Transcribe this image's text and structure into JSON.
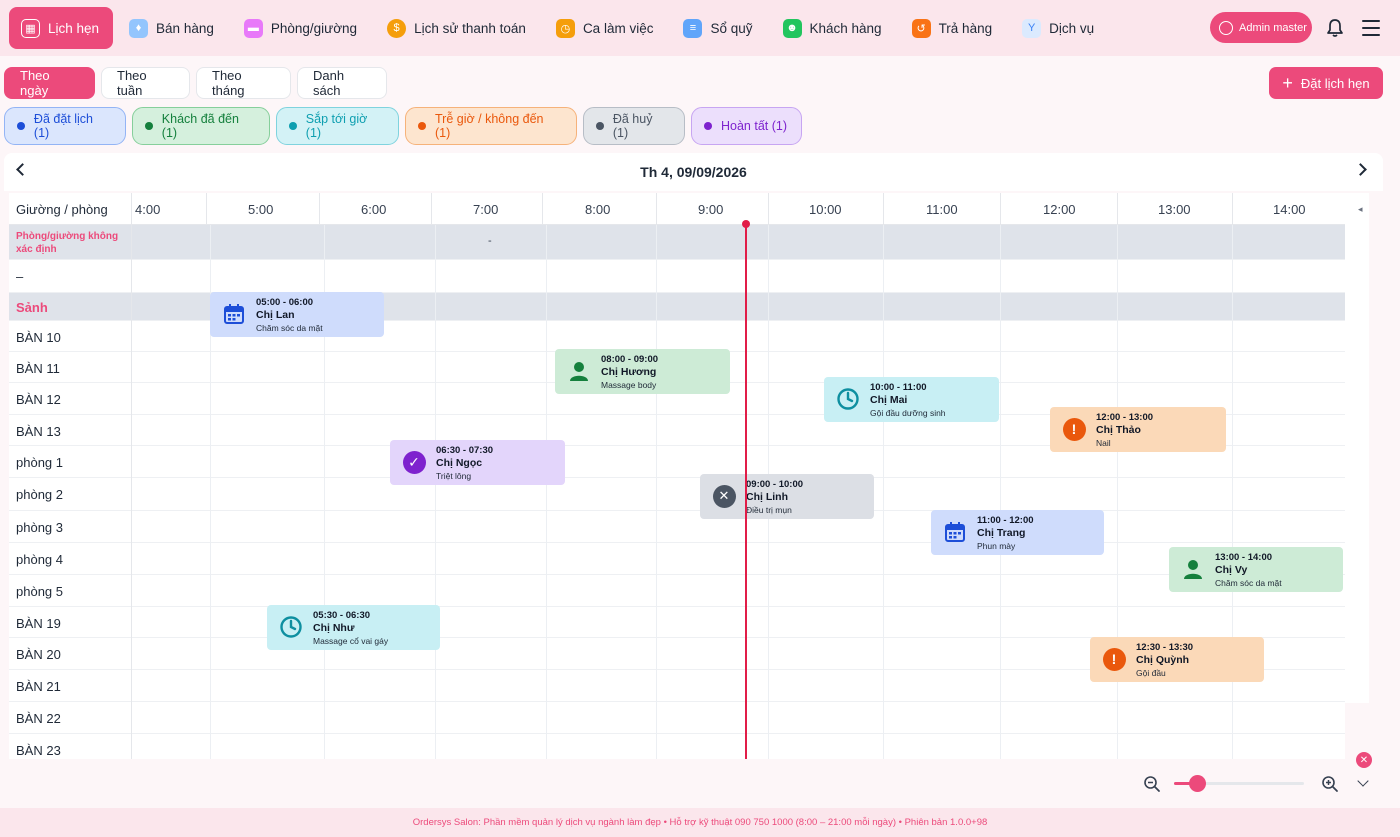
{
  "nav": {
    "items": [
      {
        "label": "Lịch hẹn",
        "icon": "calendar-icon",
        "color": "#ec4a7b",
        "active": true
      },
      {
        "label": "Bán hàng",
        "icon": "shirt-icon",
        "color": "#93c5fd"
      },
      {
        "label": "Phòng/giường",
        "icon": "bed-icon",
        "color": "#e879f9"
      },
      {
        "label": "Lịch sử thanh toán",
        "icon": "payment-history-icon",
        "color": "#f59e0b"
      },
      {
        "label": "Ca làm việc",
        "icon": "shift-icon",
        "color": "#f59e0b"
      },
      {
        "label": "Sổ quỹ",
        "icon": "cashbook-icon",
        "color": "#60a5fa"
      },
      {
        "label": "Khách hàng",
        "icon": "customers-icon",
        "color": "#22c55e"
      },
      {
        "label": "Trả hàng",
        "icon": "return-icon",
        "color": "#f97316"
      },
      {
        "label": "Dịch vụ",
        "icon": "service-icon",
        "color": "#93c5fd"
      }
    ],
    "user": "Admin master"
  },
  "view_tabs": [
    "Theo ngày",
    "Theo tuần",
    "Theo tháng",
    "Danh sách"
  ],
  "add_button": "Đặt lịch hẹn",
  "status_chips": [
    {
      "label": "Đã đặt lịch (1)",
      "color": "#1d4ed8",
      "bg": "#dbe6fd",
      "border": "#93b4f5"
    },
    {
      "label": "Khách đã đến (1)",
      "color": "#15803d",
      "bg": "#d5f0dd",
      "border": "#86cf9b"
    },
    {
      "label": "Sắp tới giờ (1)",
      "color": "#0e9fb0",
      "bg": "#d3f2f6",
      "border": "#7fd3de"
    },
    {
      "label": "Trễ giờ / không đến (1)",
      "color": "#ea580c",
      "bg": "#fde5cf",
      "border": "#f6b27a"
    },
    {
      "label": "Đã huỷ (1)",
      "color": "#4b5563",
      "bg": "#e3e6ea",
      "border": "#b7bdc6"
    },
    {
      "label": "Hoàn tất (1)",
      "color": "#7e22ce",
      "bg": "#ecdffc",
      "border": "#c7a5f2"
    }
  ],
  "date": "Th 4, 09/09/2026",
  "grid": {
    "resource_header": "Giường / phòng",
    "hours": [
      "4:00",
      "5:00",
      "6:00",
      "7:00",
      "8:00",
      "9:00",
      "10:00",
      "11:00",
      "12:00",
      "13:00",
      "14:00"
    ],
    "rows": [
      {
        "label": "Phòng/giường không xác định",
        "group": true,
        "note": "-"
      },
      {
        "label": "–"
      },
      {
        "label": "Sảnh",
        "group": true
      },
      {
        "label": "BÀN 10"
      },
      {
        "label": "BÀN 11"
      },
      {
        "label": "BÀN 12"
      },
      {
        "label": "BÀN 13"
      },
      {
        "label": "phòng 1"
      },
      {
        "label": "phòng 2"
      },
      {
        "label": "phòng 3"
      },
      {
        "label": "phòng 4"
      },
      {
        "label": "phòng 5"
      },
      {
        "label": "BÀN 19"
      },
      {
        "label": "BÀN 20"
      },
      {
        "label": "BÀN 21"
      },
      {
        "label": "BÀN 22"
      },
      {
        "label": "BÀN 23"
      }
    ]
  },
  "appointments": [
    {
      "time": "05:00 - 06:00",
      "name": "Chị Lan",
      "service": "Chăm sóc da mặt",
      "status": "booked",
      "icon": "calendar-icon",
      "icon_color": "#1d4ed8"
    },
    {
      "time": "08:00 - 09:00",
      "name": "Chị Hương",
      "service": "Massage body",
      "status": "arrived",
      "icon": "person-icon",
      "icon_color": "#15803d"
    },
    {
      "time": "10:00 - 11:00",
      "name": "Chị Mai",
      "service": "Gội đầu dưỡng sinh",
      "status": "upcoming",
      "icon": "clock-icon",
      "icon_color": "#0e8fa0"
    },
    {
      "time": "12:00 - 13:00",
      "name": "Chị Thảo",
      "service": "Nail",
      "status": "late",
      "icon": "alert-icon",
      "icon_color": "#ea580c"
    },
    {
      "time": "06:30 - 07:30",
      "name": "Chị Ngọc",
      "service": "Triệt lông",
      "status": "done",
      "icon": "check-icon",
      "icon_color": "#7e22ce"
    },
    {
      "time": "09:00 - 10:00",
      "name": "Chị Linh",
      "service": "Điều trị mụn",
      "status": "cancel",
      "icon": "x-circle-icon",
      "icon_color": "#4b5563"
    },
    {
      "time": "11:00 - 12:00",
      "name": "Chị Trang",
      "service": "Phun mày",
      "status": "booked",
      "icon": "calendar-icon",
      "icon_color": "#1d4ed8"
    },
    {
      "time": "13:00 - 14:00",
      "name": "Chị Vy",
      "service": "Chăm sóc da mặt",
      "status": "arrived",
      "icon": "person-icon",
      "icon_color": "#15803d"
    },
    {
      "time": "05:30 - 06:30",
      "name": "Chị Như",
      "service": "Massage cổ vai gáy",
      "status": "upcoming",
      "icon": "clock-icon",
      "icon_color": "#0e8fa0"
    },
    {
      "time": "12:30 - 13:30",
      "name": "Chị Quỳnh",
      "service": "Gội đầu",
      "status": "late",
      "icon": "alert-icon",
      "icon_color": "#ea580c"
    }
  ],
  "zoom": {
    "level": 0.18
  },
  "footer": "Ordersys Salon: Phần mềm quản lý dịch vụ ngành làm đẹp  •  Hỗ trợ kỹ thuật 090 750 1000 (8:00 – 21:00 mỗi ngày)  •  Phiên bản 1.0.0+98",
  "accent": "#ec4a7b"
}
